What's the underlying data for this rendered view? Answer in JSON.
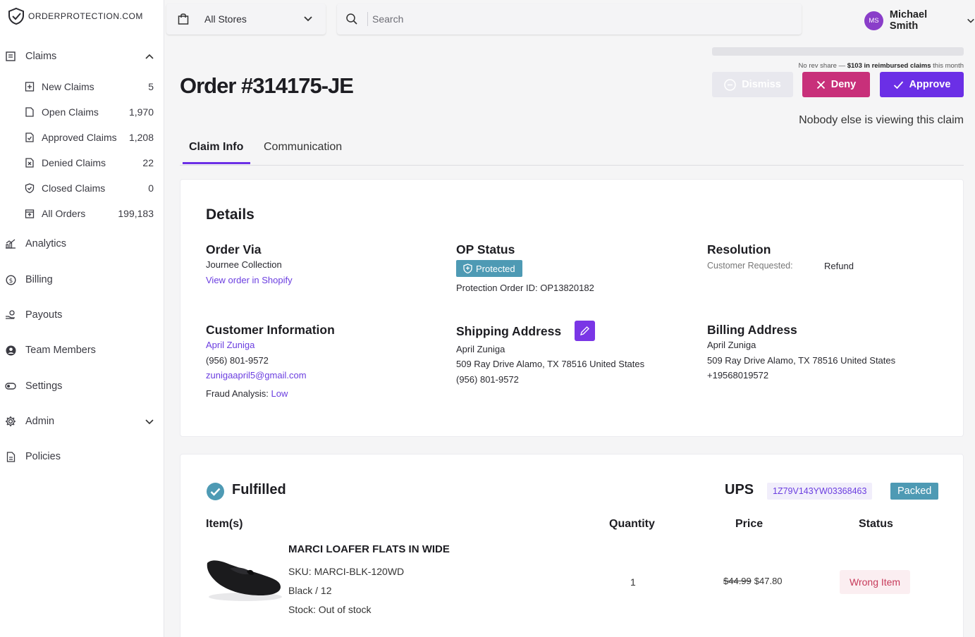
{
  "brand": {
    "logo_text": "ORDERPROTECTION.COM"
  },
  "sidebar": {
    "claims": {
      "label": "Claims"
    },
    "sub_items": [
      {
        "label": "New Claims",
        "count": "5",
        "icon": "new-claims-icon"
      },
      {
        "label": "Open Claims",
        "count": "1,970",
        "icon": "open-claims-icon"
      },
      {
        "label": "Approved Claims",
        "count": "1,208",
        "icon": "approved-claims-icon"
      },
      {
        "label": "Denied Claims",
        "count": "22",
        "icon": "denied-claims-icon"
      },
      {
        "label": "Closed Claims",
        "count": "0",
        "icon": "closed-claims-icon"
      },
      {
        "label": "All Orders",
        "count": "199,183",
        "icon": "all-orders-icon"
      }
    ],
    "analytics": "Analytics",
    "billing": "Billing",
    "payouts": "Payouts",
    "team_members": "Team Members",
    "settings": "Settings",
    "admin": "Admin",
    "policies": "Policies"
  },
  "topbar": {
    "store": "All Stores",
    "search_placeholder": "Search",
    "user_initials": "MS",
    "user_name": "Michael Smith"
  },
  "header": {
    "order_title": "Order #314175-JE",
    "rev_share_prefix": "No rev share — ",
    "rev_share_bold": "$103 in reimbursed claims",
    "rev_share_suffix": " this month",
    "dismiss": "Dismiss",
    "deny": "Deny",
    "approve": "Approve",
    "viewing_status": "Nobody else is viewing this claim"
  },
  "tabs": {
    "claim_info": "Claim Info",
    "communication": "Communication"
  },
  "details": {
    "heading": "Details",
    "order_via": {
      "title": "Order Via",
      "store": "Journee Collection",
      "link": "View order in Shopify"
    },
    "op_status": {
      "title": "OP Status",
      "badge": "Protected",
      "protection_id": "Protection Order ID: OP13820182"
    },
    "resolution": {
      "title": "Resolution",
      "label": "Customer Requested:",
      "value": "Refund"
    },
    "customer": {
      "title": "Customer Information",
      "name": "April Zuniga",
      "phone": "(956) 801-9572",
      "email": "zunigaapril5@gmail.com",
      "fraud_label": "Fraud Analysis: ",
      "fraud_value": "Low"
    },
    "shipping": {
      "title": "Shipping Address",
      "name": "April Zuniga",
      "address": "509 Ray Drive Alamo, TX 78516 United States",
      "phone": "(956) 801-9572"
    },
    "billing": {
      "title": "Billing Address",
      "name": "April Zuniga",
      "address": "509 Ray Drive Alamo, TX 78516 United States",
      "phone": "+19568019572"
    }
  },
  "fulfillment": {
    "status": "Fulfilled",
    "carrier": "UPS",
    "tracking": "1Z79V143YW03368463",
    "shipment_status": "Packed",
    "columns": {
      "items": "Item(s)",
      "quantity": "Quantity",
      "price": "Price",
      "status": "Status"
    },
    "item": {
      "name": "MARCI LOAFER FLATS IN WIDE",
      "sku": "SKU: MARCI-BLK-120WD",
      "variant": "Black / 12",
      "stock": "Stock: Out of stock",
      "quantity": "1",
      "original_price": "$44.99",
      "price": "$47.80",
      "status": "Wrong Item"
    }
  },
  "colors": {
    "accent": "#6b2fe6",
    "deny": "#c8307a",
    "badge": "#4e9ab4"
  }
}
